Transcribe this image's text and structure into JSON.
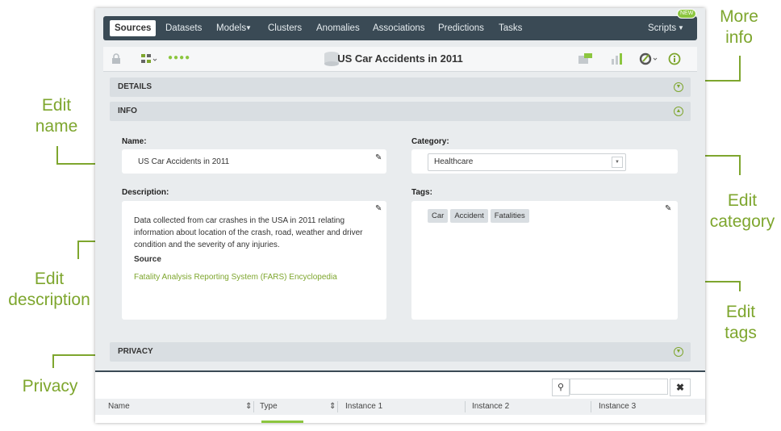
{
  "annotations": {
    "more_info": "More info",
    "edit_name": "Edit name",
    "edit_description": "Edit description",
    "edit_category": "Edit category",
    "edit_tags": "Edit tags",
    "privacy": "Privacy"
  },
  "nav": {
    "tabs": [
      "Sources",
      "Datasets",
      "Models",
      "Clusters",
      "Anomalies",
      "Associations",
      "Predictions",
      "Tasks"
    ],
    "scripts_label": "Scripts",
    "new_badge": "NEW"
  },
  "toolbar": {
    "title": "US Car Accidents in 2011"
  },
  "panels": {
    "details": "DETAILS",
    "info": "INFO",
    "privacy": "PRIVACY"
  },
  "info": {
    "name_label": "Name:",
    "name_value": "US Car Accidents in 2011",
    "category_label": "Category:",
    "category_value": "Healthcare",
    "description_label": "Description:",
    "description_text": "Data collected from car crashes in the USA in 2011 relating information about location of the crash, road, weather and driver condition and the severity of any injuries.",
    "source_heading": "Source",
    "source_link": "Fatality Analysis Reporting System (FARS) Encyclopedia",
    "tags_label": "Tags:",
    "tags": [
      "Car",
      "Accident",
      "Fatalities"
    ]
  },
  "table": {
    "search_placeholder": "",
    "columns": [
      "Name",
      "Type",
      "Instance 1",
      "Instance 2",
      "Instance 3"
    ]
  },
  "colors": {
    "accent": "#7ea62e",
    "nav_bg": "#3a4a55",
    "panel_bg": "#d9dee2"
  }
}
